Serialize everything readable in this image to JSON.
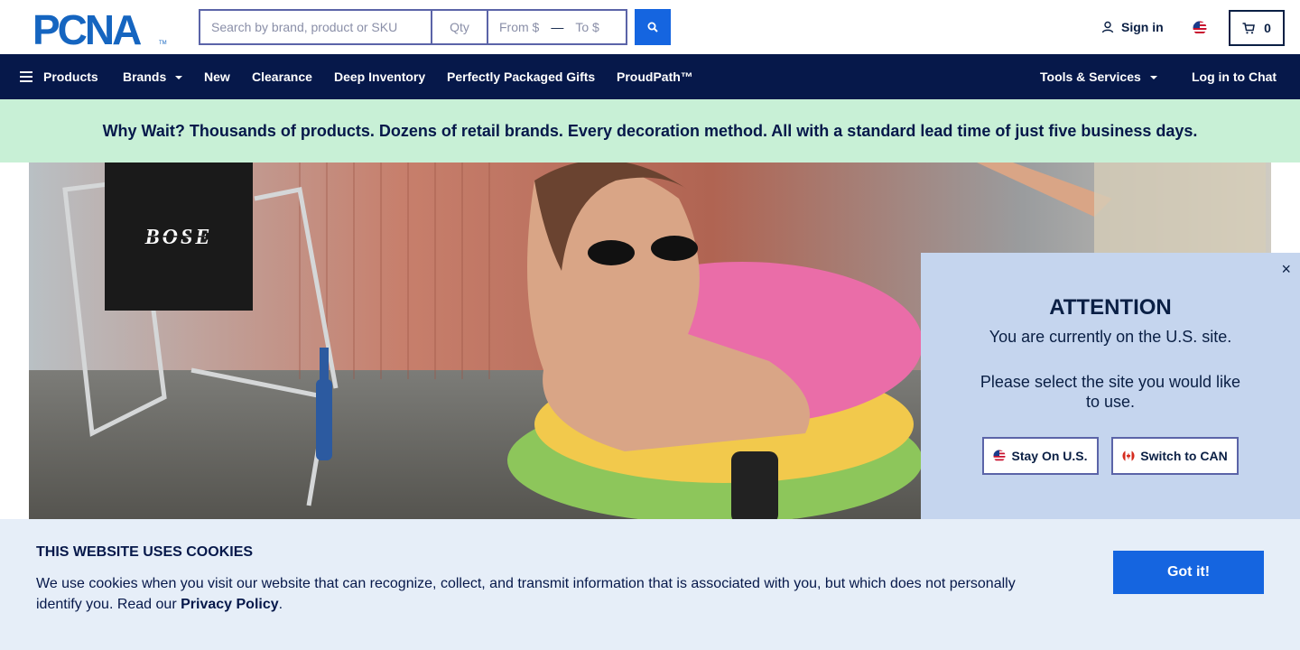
{
  "header": {
    "logo_text": "PCNA",
    "search_placeholder": "Search by brand, product or SKU",
    "qty_placeholder": "Qty",
    "from_placeholder": "From $",
    "range_separator": "—",
    "to_placeholder": "To $",
    "signin_label": "Sign in",
    "cart_count": "0",
    "brand_color": "#1565e0"
  },
  "nav": {
    "items": [
      {
        "label": "Products"
      },
      {
        "label": "Brands"
      },
      {
        "label": "New"
      },
      {
        "label": "Clearance"
      },
      {
        "label": "Deep Inventory"
      },
      {
        "label": "Perfectly Packaged Gifts"
      },
      {
        "label": "ProudPath™"
      },
      {
        "label": "Tools & Services"
      },
      {
        "label": "Log in to Chat"
      }
    ],
    "background": "#06184a"
  },
  "promo": {
    "text": "Why Wait? Thousands of products. Dozens of retail brands. Every decoration method. All with a standard lead time of just five business days.",
    "background": "#c8f0d6"
  },
  "hero": {
    "brand_logo_text": "BOSE"
  },
  "modal": {
    "close_glyph": "×",
    "title": "ATTENTION",
    "line1": "You are currently on the U.S. site.",
    "line2": "Please select the site you would like to use.",
    "stay_label": "Stay On U.S.",
    "switch_label": "Switch to CAN",
    "background": "#c5d5ee"
  },
  "cookie": {
    "title": "THIS WEBSITE USES COOKIES",
    "text": "We use cookies when you visit our website that can recognize, collect, and transmit information that is associated with you, but which does not personally identify you. Read our",
    "link_label": "Privacy Policy",
    "end_punct": ".",
    "button_label": "Got it!"
  }
}
